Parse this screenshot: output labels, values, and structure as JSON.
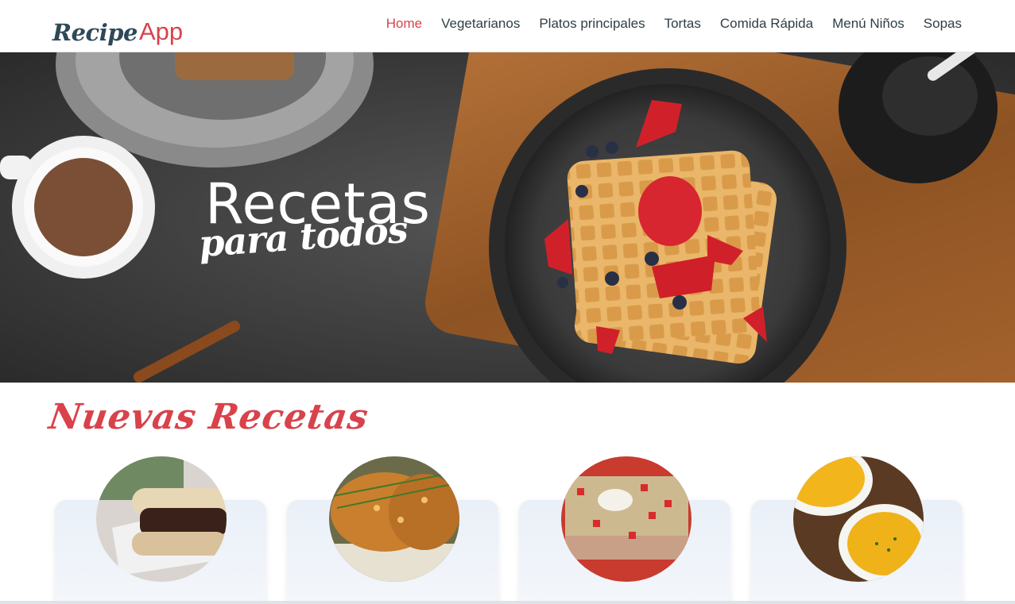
{
  "logo": {
    "part1": "Recipe",
    "part2": "App"
  },
  "nav": {
    "items": [
      {
        "label": "Home",
        "active": true
      },
      {
        "label": "Vegetarianos",
        "active": false
      },
      {
        "label": "Platos principales",
        "active": false
      },
      {
        "label": "Tortas",
        "active": false
      },
      {
        "label": "Comida Rápida",
        "active": false
      },
      {
        "label": "Menú Niños",
        "active": false
      },
      {
        "label": "Sopas",
        "active": false
      }
    ]
  },
  "hero": {
    "title": "Recetas",
    "subtitle": "para todos"
  },
  "section": {
    "title": "Nuevas Recetas"
  },
  "colors": {
    "accent": "#d9424b",
    "text": "#2f3e46",
    "card_bg": "#eaf0f8"
  }
}
